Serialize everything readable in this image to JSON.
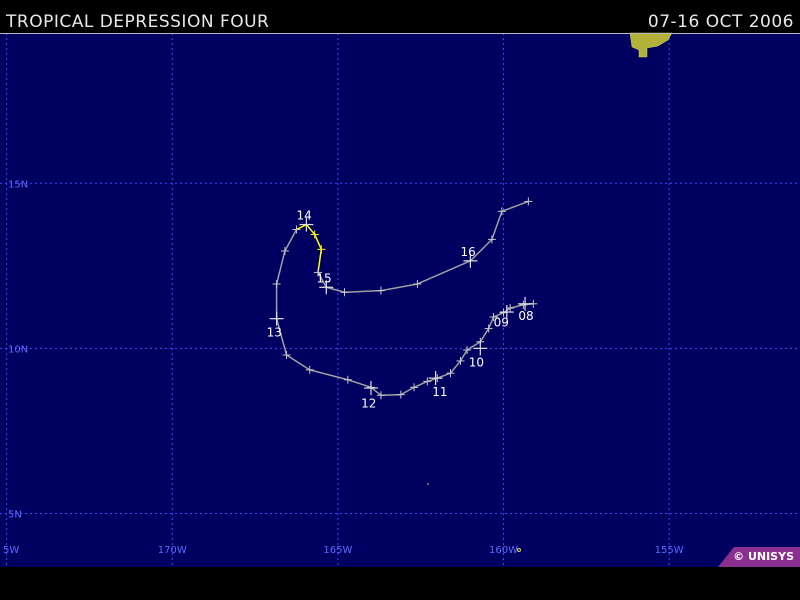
{
  "header": {
    "storm_title": "TROPICAL DEPRESSION FOUR",
    "date_range": "07-16 OCT 2006"
  },
  "credit": "© UNISYS",
  "colors": {
    "ocean": "#000060",
    "grid": "#4444ff",
    "grid_label": "#5a6cff",
    "track_depression": "#a0a0a0",
    "track_storm": "#ffff00",
    "land": "#b2b23a",
    "day_label": "#ffffff",
    "credit_bg": "#8a2f8f"
  },
  "map": {
    "lon_labels": [
      {
        "lon": -175,
        "text": "5W"
      },
      {
        "lon": -170,
        "text": "170W"
      },
      {
        "lon": -165,
        "text": "165W"
      },
      {
        "lon": -160,
        "text": "160W"
      },
      {
        "lon": -155,
        "text": "155W"
      }
    ],
    "lat_labels": [
      {
        "lat": 15,
        "text": "15N"
      },
      {
        "lat": 10,
        "text": "10N"
      },
      {
        "lat": 5,
        "text": "5N"
      }
    ],
    "lon_range": [
      -175.2,
      -151.05
    ],
    "lat_range": [
      3.38,
      19.55
    ]
  },
  "track": [
    {
      "lon": -159.1,
      "lat": 11.35,
      "type": "depression"
    },
    {
      "lon": -159.4,
      "lat": 11.32,
      "type": "depression"
    },
    {
      "lon": -159.8,
      "lat": 11.22,
      "type": "depression"
    },
    {
      "lon": -160.0,
      "lat": 11.08,
      "type": "depression"
    },
    {
      "lon": -160.3,
      "lat": 10.95,
      "type": "depression"
    },
    {
      "lon": -160.45,
      "lat": 10.6,
      "type": "depression"
    },
    {
      "lon": -160.7,
      "lat": 10.2,
      "type": "depression"
    },
    {
      "lon": -161.1,
      "lat": 9.95,
      "type": "depression"
    },
    {
      "lon": -161.3,
      "lat": 9.62,
      "type": "depression"
    },
    {
      "lon": -161.6,
      "lat": 9.25,
      "type": "depression"
    },
    {
      "lon": -162.0,
      "lat": 9.1,
      "type": "depression"
    },
    {
      "lon": -162.3,
      "lat": 9.0,
      "type": "depression"
    },
    {
      "lon": -162.7,
      "lat": 8.82,
      "type": "depression"
    },
    {
      "lon": -163.1,
      "lat": 8.6,
      "type": "depression"
    },
    {
      "lon": -163.7,
      "lat": 8.58,
      "type": "depression"
    },
    {
      "lon": -164.0,
      "lat": 8.82,
      "type": "depression"
    },
    {
      "lon": -164.7,
      "lat": 9.05,
      "type": "depression"
    },
    {
      "lon": -165.85,
      "lat": 9.35,
      "type": "depression"
    },
    {
      "lon": -166.55,
      "lat": 9.8,
      "type": "depression"
    },
    {
      "lon": -166.85,
      "lat": 10.9,
      "type": "depression"
    },
    {
      "lon": -166.85,
      "lat": 11.95,
      "type": "depression"
    },
    {
      "lon": -166.6,
      "lat": 12.95,
      "type": "depression"
    },
    {
      "lon": -166.25,
      "lat": 13.6,
      "type": "depression"
    },
    {
      "lon": -165.95,
      "lat": 13.75,
      "type": "storm"
    },
    {
      "lon": -165.7,
      "lat": 13.45,
      "type": "storm"
    },
    {
      "lon": -165.5,
      "lat": 13.0,
      "type": "storm"
    },
    {
      "lon": -165.6,
      "lat": 12.3,
      "type": "depression"
    },
    {
      "lon": -165.35,
      "lat": 11.85,
      "type": "depression"
    },
    {
      "lon": -164.8,
      "lat": 11.7,
      "type": "depression"
    },
    {
      "lon": -163.7,
      "lat": 11.75,
      "type": "depression"
    },
    {
      "lon": -162.6,
      "lat": 11.95,
      "type": "depression"
    },
    {
      "lon": -161.0,
      "lat": 12.65,
      "type": "depression"
    },
    {
      "lon": -160.35,
      "lat": 13.3,
      "type": "depression"
    },
    {
      "lon": -160.05,
      "lat": 14.15,
      "type": "depression"
    },
    {
      "lon": -159.25,
      "lat": 14.45,
      "type": "depression"
    }
  ],
  "day_markers": [
    {
      "text": "08",
      "lon": -159.35,
      "lat": 11.35,
      "label_dlon": -0.2,
      "label_dlat": -0.25
    },
    {
      "text": "09",
      "lon": -159.9,
      "lat": 11.1,
      "label_dlon": -0.4,
      "label_dlat": -0.2
    },
    {
      "text": "10",
      "lon": -160.7,
      "lat": 10.0,
      "label_dlon": -0.35,
      "label_dlat": -0.3
    },
    {
      "text": "11",
      "lon": -162.05,
      "lat": 9.1,
      "label_dlon": -0.1,
      "label_dlat": -0.3
    },
    {
      "text": "12",
      "lon": -164.0,
      "lat": 8.8,
      "label_dlon": -0.3,
      "label_dlat": -0.35
    },
    {
      "text": "13",
      "lon": -166.85,
      "lat": 10.9,
      "label_dlon": -0.3,
      "label_dlat": -0.3
    },
    {
      "text": "14",
      "lon": -165.95,
      "lat": 13.75,
      "label_dlon": -0.3,
      "label_dlat": 0.15
    },
    {
      "text": "15",
      "lon": -165.35,
      "lat": 11.85,
      "label_dlon": -0.3,
      "label_dlat": 0.15
    },
    {
      "text": "16",
      "lon": -161.0,
      "lat": 12.65,
      "label_dlon": -0.3,
      "label_dlat": 0.15
    }
  ]
}
